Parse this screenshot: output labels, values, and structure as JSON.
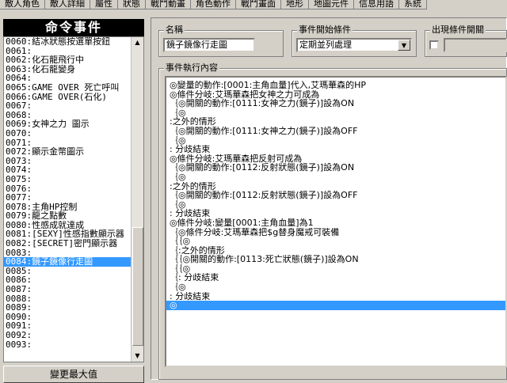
{
  "tabs": [
    "敵人角色",
    "敵人詳細",
    "屬性",
    "狀態",
    "戰鬥動畫",
    "角色動作",
    "戰鬥畫面",
    "地形",
    "地圖元件",
    "信息用語",
    "系統"
  ],
  "left": {
    "title": "命令事件",
    "items": [
      {
        "label": "0060:結冰狀態按選單按鈕",
        "selected": false
      },
      {
        "label": "0061:",
        "selected": false
      },
      {
        "label": "0062:化石龍飛行中",
        "selected": false
      },
      {
        "label": "0063:化石龍變身",
        "selected": false
      },
      {
        "label": "0064:",
        "selected": false
      },
      {
        "label": "0065:GAME OVER 死亡呼叫",
        "selected": false
      },
      {
        "label": "0066:GAME OVER(石化)",
        "selected": false
      },
      {
        "label": "0067:",
        "selected": false
      },
      {
        "label": "0068:",
        "selected": false
      },
      {
        "label": "0069:女神之力 圖示",
        "selected": false
      },
      {
        "label": "0070:",
        "selected": false
      },
      {
        "label": "0071:",
        "selected": false
      },
      {
        "label": "0072:顯示金幣圖示",
        "selected": false
      },
      {
        "label": "0073:",
        "selected": false
      },
      {
        "label": "0074:",
        "selected": false
      },
      {
        "label": "0075:",
        "selected": false
      },
      {
        "label": "0076:",
        "selected": false
      },
      {
        "label": "0077:",
        "selected": false
      },
      {
        "label": "0078:主角HP控制",
        "selected": false
      },
      {
        "label": "0079:龍之點數",
        "selected": false
      },
      {
        "label": "0080:性感成就達成",
        "selected": false
      },
      {
        "label": "0081:[SEXY]性感指數顯示器",
        "selected": false
      },
      {
        "label": "0082:[SECRET]密門顯示器",
        "selected": false
      },
      {
        "label": "0083:",
        "selected": false
      },
      {
        "label": "0084:鏡子鏡像行走圖",
        "selected": true
      },
      {
        "label": "0085:",
        "selected": false
      },
      {
        "label": "0086:",
        "selected": false
      },
      {
        "label": "0087:",
        "selected": false
      },
      {
        "label": "0088:",
        "selected": false
      },
      {
        "label": "0089:",
        "selected": false
      },
      {
        "label": "0090:",
        "selected": false
      },
      {
        "label": "0091:",
        "selected": false
      },
      {
        "label": "0092:",
        "selected": false
      },
      {
        "label": "0093:",
        "selected": false
      }
    ],
    "max_button": "變更最大值"
  },
  "form": {
    "name_label": "名稱",
    "name_value": "鏡子鏡像行走圖",
    "trigger_label": "事件開始條件",
    "trigger_value": "定期並列處理",
    "switch_label": "出現條件開關",
    "content_label": "事件執行內容"
  },
  "commands": [
    {
      "text": "◎變量的動作:[0001:主角血量]代入,艾瑪華森的HP",
      "selected": false
    },
    {
      "text": "◎條件分岐:艾瑪華森把女神之力可成為",
      "selected": false
    },
    {
      "text": " ｛◎開關的動作:[0111:女神之力(鏡子)]設為ON",
      "selected": false
    },
    {
      "text": " ｛◎",
      "selected": false
    },
    {
      "text": ":之外的情形",
      "selected": false
    },
    {
      "text": " ｛◎開關的動作:[0111:女神之力(鏡子)]設為OFF",
      "selected": false
    },
    {
      "text": " ｛◎",
      "selected": false
    },
    {
      "text": ": 分歧結束",
      "selected": false
    },
    {
      "text": "◎條件分岐:艾瑪華森把反射可成為",
      "selected": false
    },
    {
      "text": " ｛◎開關的動作:[0112:反射狀態(鏡子)]設為ON",
      "selected": false
    },
    {
      "text": " ｛◎",
      "selected": false
    },
    {
      "text": ":之外的情形",
      "selected": false
    },
    {
      "text": " ｛◎開關的動作:[0112:反射狀態(鏡子)]設為OFF",
      "selected": false
    },
    {
      "text": " ｛◎",
      "selected": false
    },
    {
      "text": ": 分歧結束",
      "selected": false
    },
    {
      "text": "◎條件分岐:變量[0001:主角血量]為1",
      "selected": false
    },
    {
      "text": " ｛◎條件分岐:艾瑪華森把$g替身魔戒可裝備",
      "selected": false
    },
    {
      "text": " ｛｛◎",
      "selected": false
    },
    {
      "text": " ｛:之外的情形",
      "selected": false
    },
    {
      "text": " ｛｛◎開關的動作:[0113:死亡狀態(鏡子)]設為ON",
      "selected": false
    },
    {
      "text": " ｛｛◎",
      "selected": false
    },
    {
      "text": " ｛: 分歧結束",
      "selected": false
    },
    {
      "text": " ｛◎",
      "selected": false
    },
    {
      "text": ": 分歧結束",
      "selected": false
    },
    {
      "text": "◎",
      "selected": true
    }
  ]
}
